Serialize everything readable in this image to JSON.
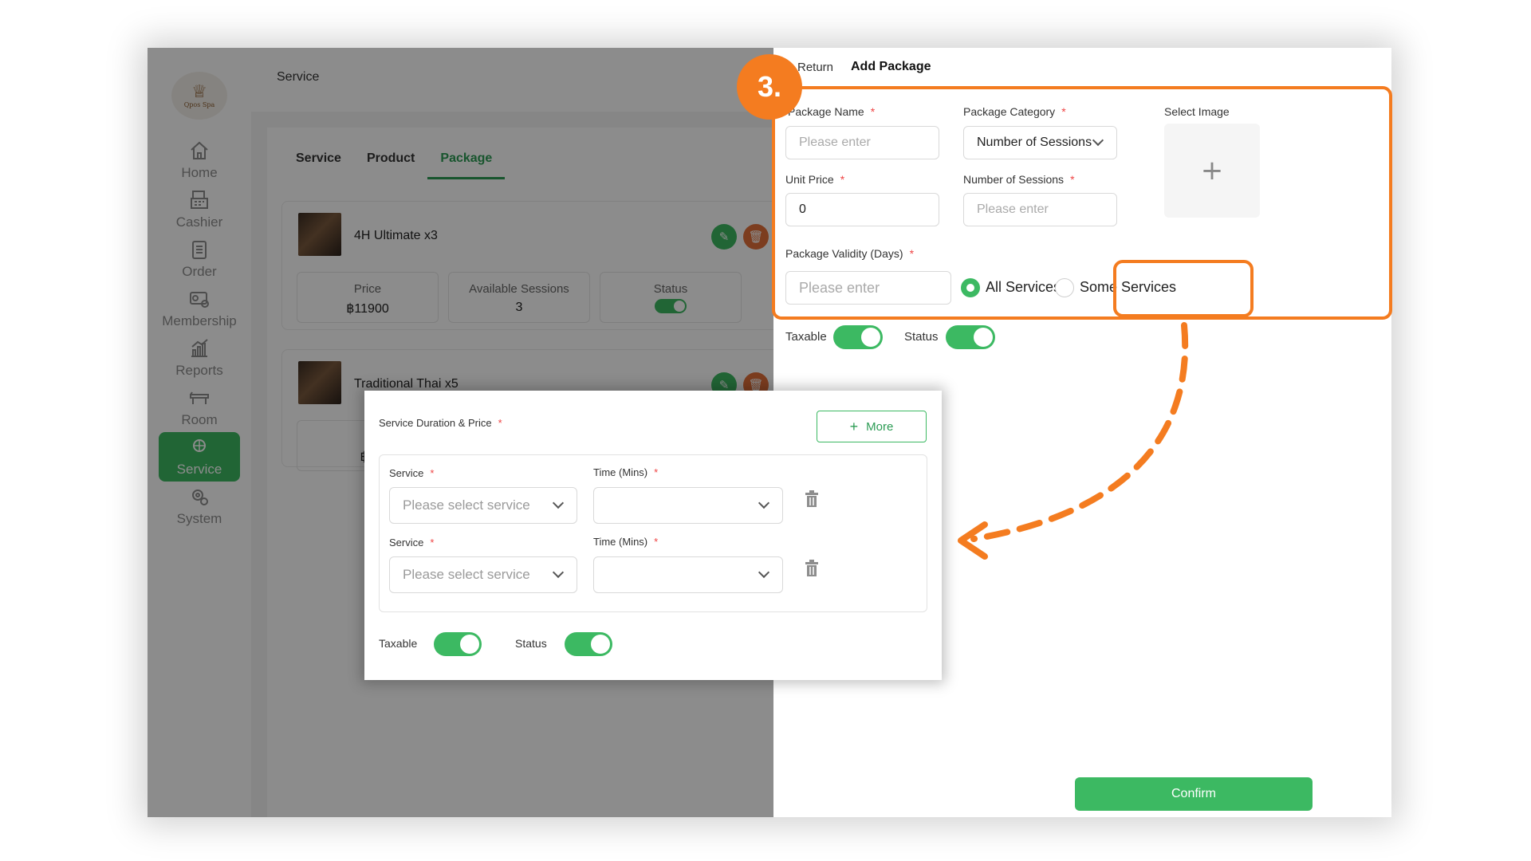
{
  "step_number": "3.",
  "accent_color": "#3cb962",
  "highlight_color": "#f47c20",
  "sidebar": {
    "logo_mark": "♕",
    "logo_text": "Qpos Spa",
    "items": [
      {
        "label": "Home",
        "icon": "home-icon"
      },
      {
        "label": "Cashier",
        "icon": "cashier-icon"
      },
      {
        "label": "Order",
        "icon": "order-icon"
      },
      {
        "label": "Membership",
        "icon": "membership-icon"
      },
      {
        "label": "Reports",
        "icon": "reports-icon"
      },
      {
        "label": "Room",
        "icon": "room-icon"
      },
      {
        "label": "Service",
        "icon": "service-icon",
        "active": true
      },
      {
        "label": "System",
        "icon": "system-icon"
      }
    ]
  },
  "header": {
    "breadcrumb": "Service"
  },
  "tabs": [
    "Service",
    "Product",
    "Package"
  ],
  "packages": [
    {
      "title": "4H Ultimate x3",
      "price_label": "Price",
      "price_value": "฿11900",
      "sessions_label": "Available Sessions",
      "sessions_value": "3",
      "status_label": "Status"
    },
    {
      "title": "Traditional Thai x5",
      "price_label": "P",
      "price_value": "฿1"
    }
  ],
  "drawer": {
    "return_label": "Return",
    "title": "Add Package",
    "package_name_label": "Package Name",
    "package_name_placeholder": "Please enter",
    "package_category_label": "Package Category",
    "package_category_value": "Number of Sessions",
    "select_image_label": "Select Image",
    "select_image_plus": "+",
    "unit_price_label": "Unit Price",
    "unit_price_value": "0",
    "number_sessions_label": "Number of Sessions",
    "number_sessions_placeholder": "Please enter",
    "validity_label": "Package Validity (Days)",
    "validity_placeholder": "Please enter",
    "all_services_label": "All Services",
    "some_services_label": "Some Services",
    "taxable_label": "Taxable",
    "status_label": "Status",
    "confirm_label": "Confirm",
    "required_mark": "*"
  },
  "popup": {
    "title": "Service Duration & Price",
    "more_label": "More",
    "more_plus": "+",
    "rows": [
      {
        "service_label": "Service",
        "service_placeholder": "Please select service",
        "time_label": "Time (Mins)"
      },
      {
        "service_label": "Service",
        "service_placeholder": "Please select service",
        "time_label": "Time (Mins)"
      }
    ],
    "taxable_label": "Taxable",
    "status_label": "Status"
  }
}
